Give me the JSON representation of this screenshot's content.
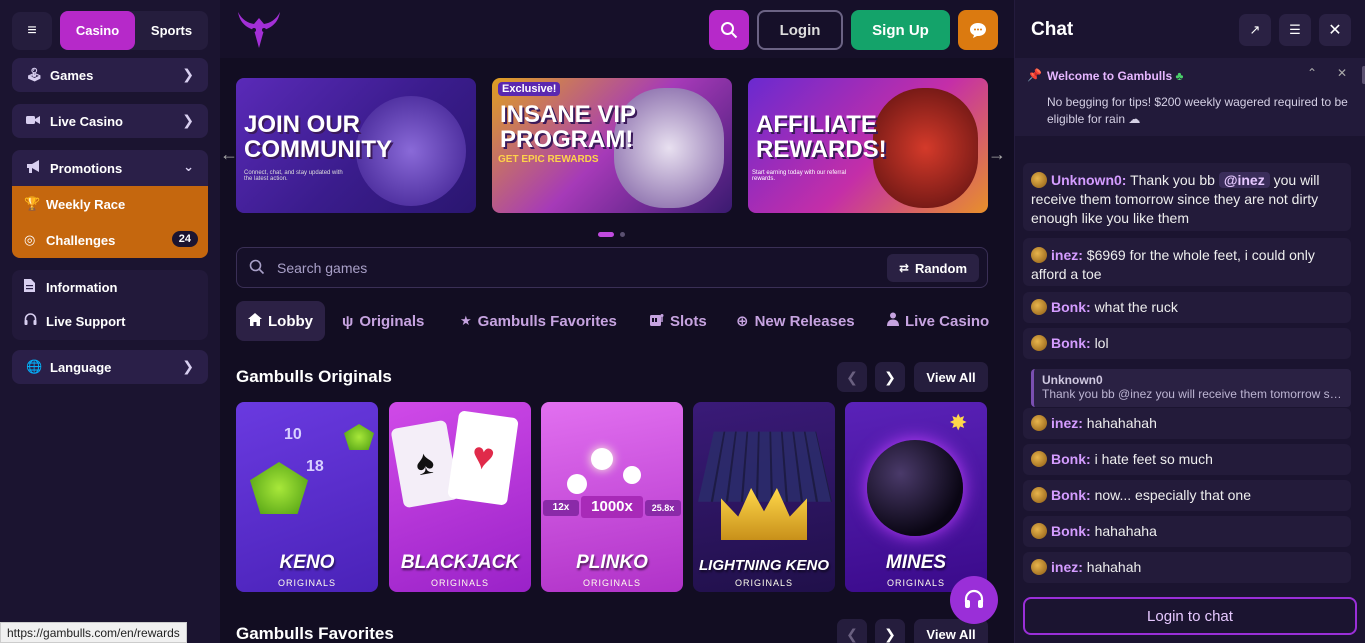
{
  "topbar": {
    "casino_label": "Casino",
    "sports_label": "Sports",
    "login_label": "Login",
    "signup_label": "Sign Up"
  },
  "sidebar": {
    "items": [
      {
        "label": "Games",
        "icon": "joystick-icon"
      },
      {
        "label": "Live Casino",
        "icon": "camera-icon"
      },
      {
        "label": "Promotions",
        "icon": "megaphone-icon"
      }
    ],
    "promotions_sub": [
      {
        "label": "Weekly Race",
        "icon": "trophy-icon"
      },
      {
        "label": "Challenges",
        "icon": "target-icon",
        "badge": "24"
      }
    ],
    "info": [
      {
        "label": "Information",
        "icon": "document-icon"
      },
      {
        "label": "Live Support",
        "icon": "headset-icon"
      }
    ],
    "language_label": "Language"
  },
  "banners": [
    {
      "title_line1": "JOIN OUR",
      "title_line2": "COMMUNITY",
      "caption": "Connect, chat, and stay updated with the latest action."
    },
    {
      "tag": "Exclusive!",
      "title_line1": "INSANE VIP",
      "title_line2": "PROGRAM!",
      "caption": "GET EPIC REWARDS"
    },
    {
      "title_line1": "AFFILIATE",
      "title_line2": "REWARDS!",
      "caption": "Start earning today with our referral rewards."
    }
  ],
  "search": {
    "placeholder": "Search games",
    "random_label": "Random"
  },
  "tabs": [
    {
      "label": "Lobby",
      "icon": "home-icon"
    },
    {
      "label": "Originals",
      "icon": "bull-icon"
    },
    {
      "label": "Gambulls Favorites",
      "icon": "star-icon"
    },
    {
      "label": "Slots",
      "icon": "slot-icon"
    },
    {
      "label": "New Releases",
      "icon": "plus-circle-icon"
    },
    {
      "label": "Live Casino",
      "icon": "dealer-icon"
    }
  ],
  "originals": {
    "title": "Gambulls Originals",
    "view_all": "View All",
    "games": [
      {
        "name": "KENO",
        "sub": "ORIGINALS"
      },
      {
        "name": "BLACKJACK",
        "sub": "ORIGINALS"
      },
      {
        "name": "PLINKO",
        "sub": "ORIGINALS",
        "multis": [
          "12x",
          "1000x",
          "25.8x"
        ]
      },
      {
        "name": "LIGHTNING KENO",
        "sub": "ORIGINALS"
      },
      {
        "name": "MINES",
        "sub": "ORIGINALS"
      }
    ]
  },
  "favorites": {
    "title": "Gambulls Favorites",
    "view_all": "View All"
  },
  "status_url": "https://gambulls.com/en/rewards",
  "chat": {
    "title": "Chat",
    "welcome_title": "Welcome to Gambulls",
    "welcome_msg": "No begging for tips! $200 weekly wagered required to be eligible for rain",
    "messages": [
      {
        "user": "Unknown0:",
        "before": "Thank you bb",
        "mention": "@inez",
        "after": "you will receive them tomorrow since they are not dirty enough like you like them"
      },
      {
        "user": "inez:",
        "text": "$6969 for the whole feet, i could only afford a toe"
      },
      {
        "user": "Bonk:",
        "text": "what the ruck"
      },
      {
        "user": "Bonk:",
        "text": "lol"
      },
      {
        "user": "inez:",
        "text": "hahahahah"
      },
      {
        "user": "Bonk:",
        "text": "i hate feet so much"
      },
      {
        "user": "Bonk:",
        "text": "now... especially that one"
      },
      {
        "user": "Bonk:",
        "text": "hahahaha"
      },
      {
        "user": "inez:",
        "text": "hahahah"
      }
    ],
    "quote_user": "Unknown0",
    "quote_text": "Thank you bb @inez you will receive them tomorrow since they are not dirty enough like you like them",
    "login_to_chat": "Login to chat"
  }
}
